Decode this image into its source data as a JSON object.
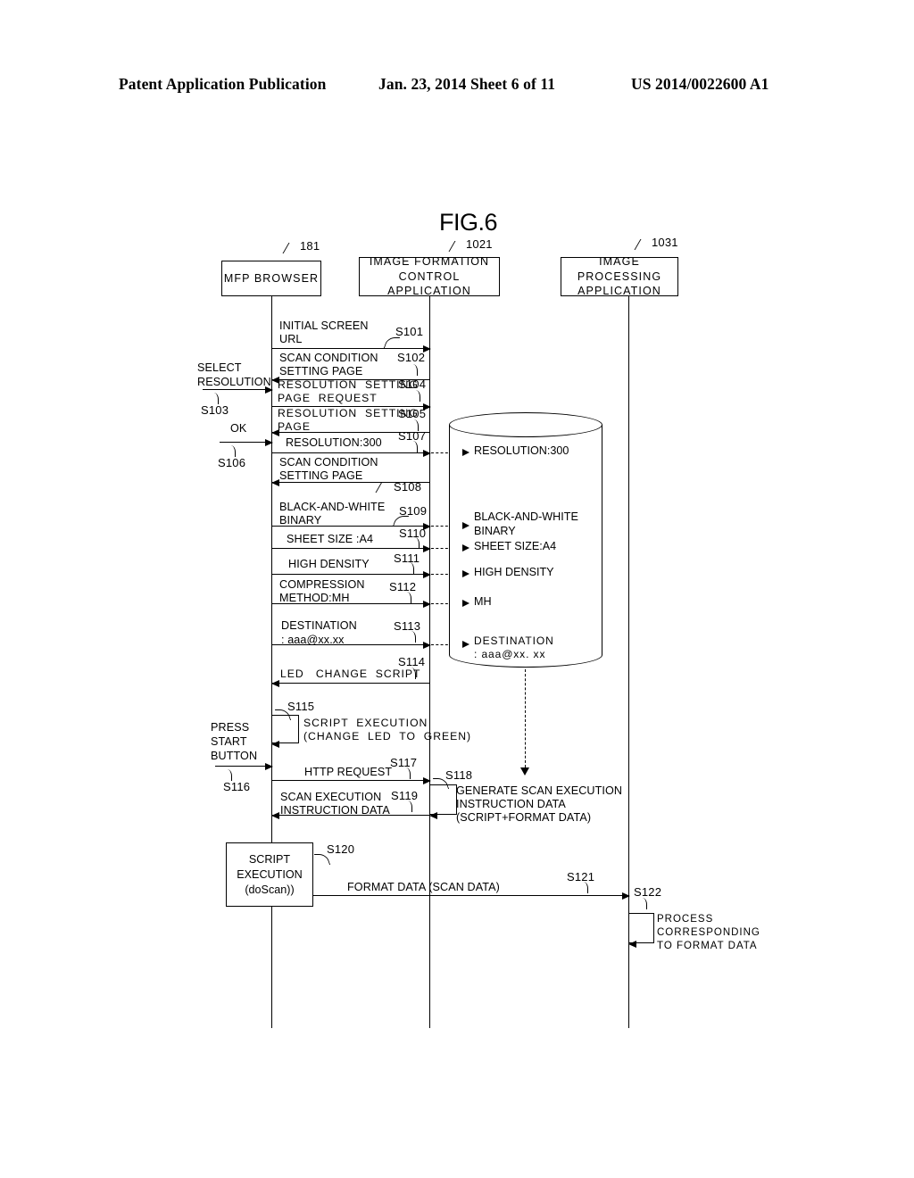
{
  "header": {
    "publication": "Patent Application Publication",
    "date_sheet": "Jan. 23, 2014  Sheet 6 of 11",
    "number": "US 2014/0022600 A1"
  },
  "figure": {
    "title": "FIG.6"
  },
  "actors": [
    {
      "id": "mfp",
      "label": "MFP  BROWSER",
      "ref": "181"
    },
    {
      "id": "ifca",
      "label_line1": "IMAGE FORMATION",
      "label_line2": "CONTROL  APPLICATION",
      "ref": "1021"
    },
    {
      "id": "ipa",
      "label_line1": "IMAGE PROCESSING",
      "label_line2": "APPLICATION",
      "ref": "1031"
    }
  ],
  "user_actions": [
    {
      "label_line1": "SELECT",
      "label_line2": "RESOLUTION",
      "step": "S103"
    },
    {
      "label_line1": "OK",
      "step": "S106"
    },
    {
      "label_line1": "PRESS",
      "label_line2": "START",
      "label_line3": "BUTTON",
      "step": "S116"
    }
  ],
  "messages": [
    {
      "step": "S101",
      "line1": "INITIAL SCREEN",
      "line2": "URL"
    },
    {
      "step": "S102",
      "line1": "SCAN CONDITION",
      "line2": "SETTING PAGE"
    },
    {
      "step": "S104",
      "line1": "RESOLUTION  SETTING",
      "line2": "PAGE  REQUEST"
    },
    {
      "step": "S105",
      "line1": "RESOLUTION  SETTING",
      "line2": "PAGE"
    },
    {
      "step": "S107",
      "line1": "RESOLUTION:300"
    },
    {
      "step": "S108",
      "line1": "SCAN CONDITION",
      "line2": "SETTING PAGE"
    },
    {
      "step": "S109",
      "line1": "BLACK-AND-WHITE",
      "line2": "BINARY"
    },
    {
      "step": "S110",
      "line1": "SHEET SIZE :A4"
    },
    {
      "step": "S111",
      "line1": "HIGH DENSITY"
    },
    {
      "step": "S112",
      "line1": "COMPRESSION",
      "line2": "METHOD:MH"
    },
    {
      "step": "S113",
      "line1": "DESTINATION",
      "line2": ": aaa@xx.xx"
    },
    {
      "step": "S114",
      "line1": "LED   CHANGE  SCRIPT"
    },
    {
      "step": "S115",
      "line1": "SCRIPT  EXECUTION",
      "line2": "(CHANGE  LED  TO  GREEN)"
    },
    {
      "step": "S117",
      "line1": "HTTP REQUEST"
    },
    {
      "step": "S118",
      "line1": "GENERATE SCAN EXECUTION",
      "line2": "INSTRUCTION DATA",
      "line3": "(SCRIPT+FORMAT DATA)"
    },
    {
      "step": "S119",
      "line1": "SCAN EXECUTION",
      "line2": "INSTRUCTION DATA"
    },
    {
      "step": "S120",
      "line1": "SCRIPT",
      "line2": "EXECUTION",
      "line3": "(doScan))"
    },
    {
      "step": "S121",
      "line1": "FORMAT DATA (SCAN DATA)"
    },
    {
      "step": "S122",
      "line1": "PROCESS",
      "line2": "CORRESPONDING",
      "line3": "TO FORMAT DATA"
    }
  ],
  "database_entries": [
    {
      "line1": "RESOLUTION:300"
    },
    {
      "line1": "BLACK-AND-WHITE",
      "line2": "BINARY"
    },
    {
      "line1": "SHEET SIZE:A4"
    },
    {
      "line1": "HIGH DENSITY"
    },
    {
      "line1": "MH"
    },
    {
      "line1": "DESTINATION",
      "line2": ": aaa@xx. xx"
    }
  ]
}
